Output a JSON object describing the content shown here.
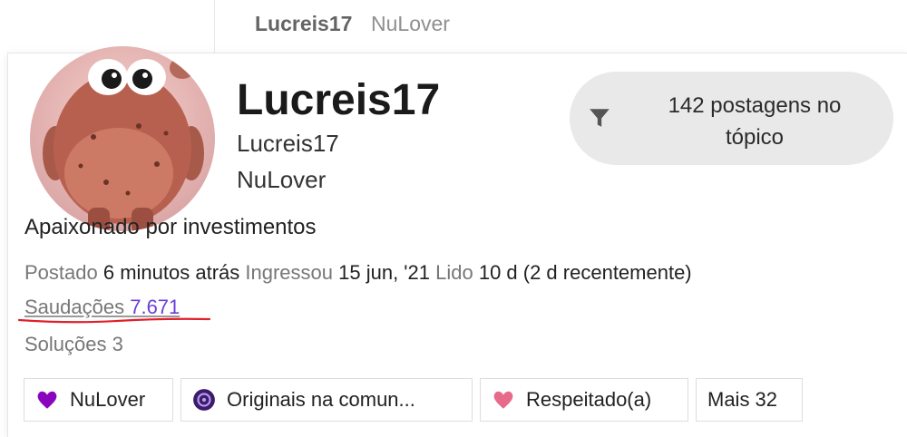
{
  "post_header": {
    "username": "Lucreis17",
    "flair": "NuLover"
  },
  "user_card": {
    "name": "Lucreis17",
    "username": "Lucreis17",
    "title": "NuLover",
    "filter_button": {
      "label": "142 postagens no tópico",
      "icon": "filter-icon"
    },
    "bio": "Apaixonado por investimentos",
    "meta": {
      "posted_label": "Postado",
      "posted_value": "6 minutos atrás",
      "joined_label": "Ingressou",
      "joined_value": "15 jun, '21",
      "read_label": "Lido",
      "read_value": "10 d (2 d recentemente)"
    },
    "likes": {
      "label": "Saudações",
      "value": "7.671"
    },
    "solutions": {
      "label": "Soluções",
      "value": "3"
    },
    "badges": [
      {
        "label": "NuLover",
        "icon": "heart-icon",
        "color": "#8a05be"
      },
      {
        "label": "Originais na comun...",
        "icon": "community-icon",
        "color": "#3b1b6e"
      },
      {
        "label": "Respeitado(a)",
        "icon": "heart-icon",
        "color": "#e86a8a"
      },
      {
        "label": "Mais 32"
      }
    ]
  },
  "colors": {
    "accent_purple": "#6a3fd8",
    "annotation_red": "#e0202a",
    "filter_bg": "#e9e9e9"
  }
}
